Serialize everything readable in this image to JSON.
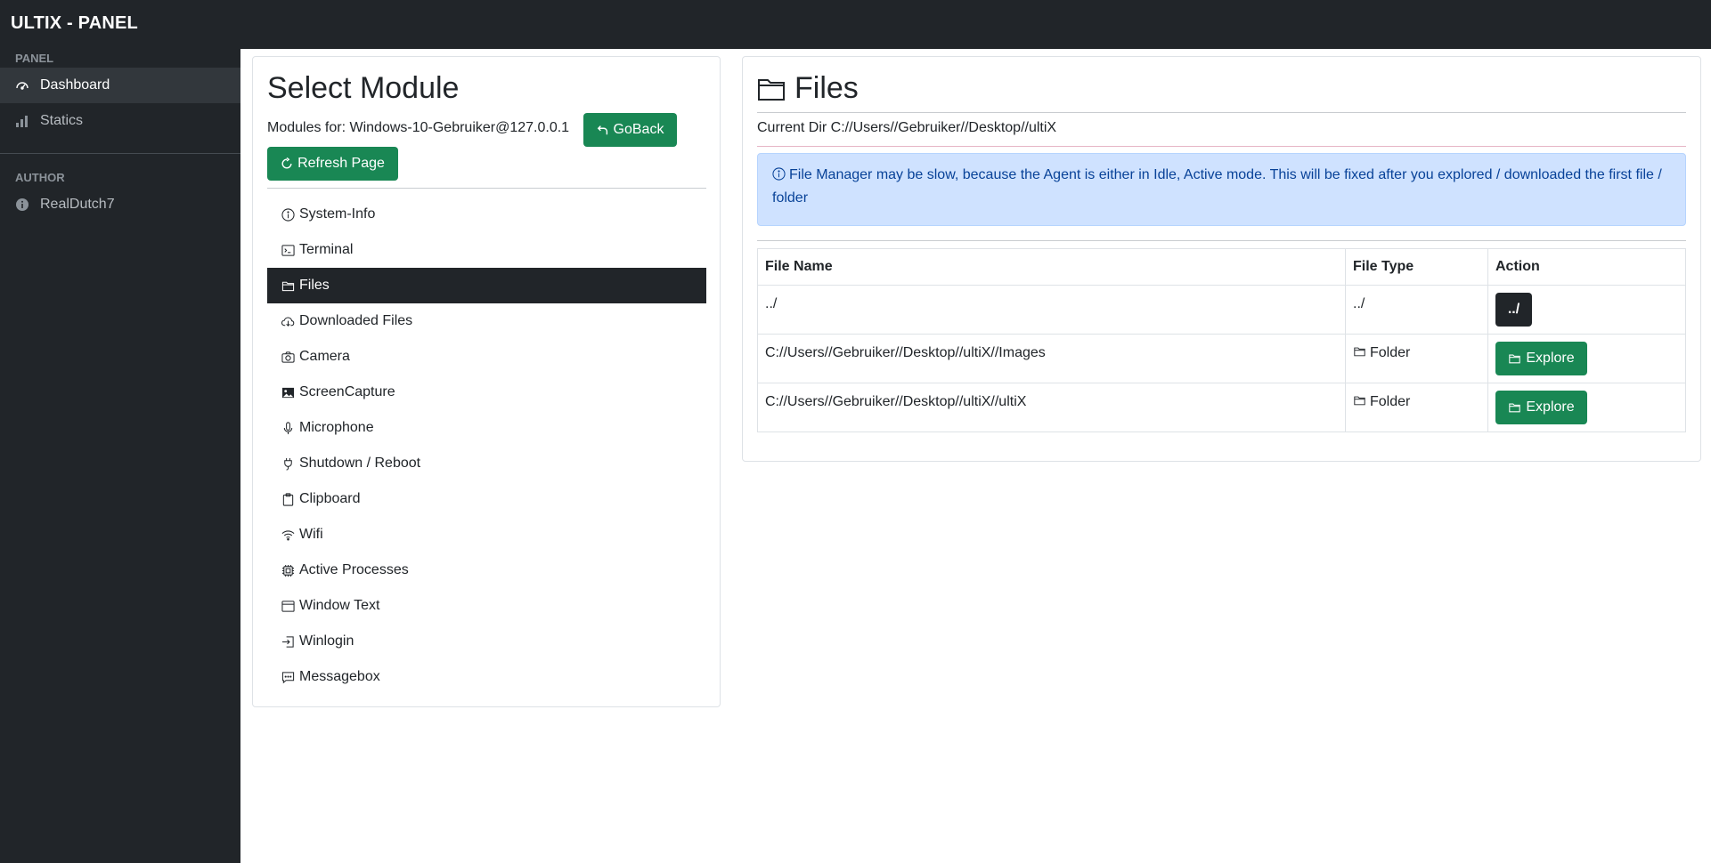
{
  "app": {
    "title": "ULTIX - PANEL"
  },
  "sidebar": {
    "panel_heading": "PANEL",
    "items": [
      {
        "label": "Dashboard",
        "icon": "speedometer-icon",
        "active": true
      },
      {
        "label": "Statics",
        "icon": "bar-chart-icon",
        "active": false
      }
    ],
    "author_heading": "AUTHOR",
    "author": {
      "label": "RealDutch7",
      "icon": "info-circle-icon"
    }
  },
  "modules": {
    "title": "Select Module",
    "modules_for": "Modules for: Windows-10-Gebruiker@127.0.0.1",
    "goback_label": "GoBack",
    "refresh_label": "Refresh Page",
    "items": [
      {
        "label": "System-Info",
        "icon": "info-circle-icon"
      },
      {
        "label": "Terminal",
        "icon": "terminal-icon"
      },
      {
        "label": "Files",
        "icon": "folder-icon",
        "active": true
      },
      {
        "label": "Downloaded Files",
        "icon": "cloud-download-icon"
      },
      {
        "label": "Camera",
        "icon": "camera-icon"
      },
      {
        "label": "ScreenCapture",
        "icon": "image-icon"
      },
      {
        "label": "Microphone",
        "icon": "microphone-icon"
      },
      {
        "label": "Shutdown / Reboot",
        "icon": "plug-icon"
      },
      {
        "label": "Clipboard",
        "icon": "clipboard-icon"
      },
      {
        "label": "Wifi",
        "icon": "wifi-icon"
      },
      {
        "label": "Active Processes",
        "icon": "cpu-icon"
      },
      {
        "label": "Window Text",
        "icon": "window-icon"
      },
      {
        "label": "Winlogin",
        "icon": "login-icon"
      },
      {
        "label": "Messagebox",
        "icon": "chat-icon"
      }
    ]
  },
  "files": {
    "title": "Files",
    "current_dir": "Current Dir C://Users//Gebruiker//Desktop//ultiX",
    "alert": "File Manager may be slow, because the Agent is either in Idle, Active mode. This will be fixed after you explored / downloaded the first file / folder",
    "headers": {
      "name": "File Name",
      "type": "File Type",
      "action": "Action"
    },
    "rows": [
      {
        "name": "../",
        "type": "../",
        "action": "../"
      },
      {
        "name": "C://Users//Gebruiker//Desktop//ultiX//Images",
        "type": "Folder",
        "action": "Explore"
      },
      {
        "name": "C://Users//Gebruiker//Desktop//ultiX//ultiX",
        "type": "Folder",
        "action": "Explore"
      }
    ]
  },
  "colors": {
    "topbar": "#212529",
    "sidebar": "#212529",
    "accent_green": "#198754",
    "alert_bg": "#cfe2ff",
    "alert_text": "#084298"
  }
}
